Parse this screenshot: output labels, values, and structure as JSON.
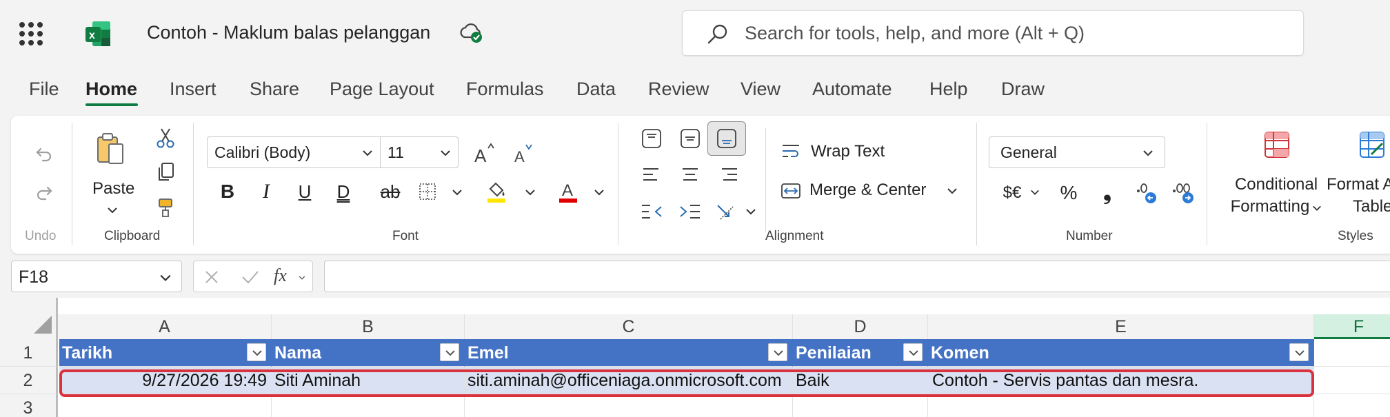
{
  "app": {
    "doc_title": "Contoh - Maklum balas pelanggan",
    "search_placeholder": "Search for tools, help, and more (Alt + Q)",
    "brand_color": "#107c41"
  },
  "menu_tabs": [
    {
      "label": "File",
      "active": false
    },
    {
      "label": "Home",
      "active": true
    },
    {
      "label": "Insert",
      "active": false
    },
    {
      "label": "Share",
      "active": false
    },
    {
      "label": "Page Layout",
      "active": false
    },
    {
      "label": "Formulas",
      "active": false
    },
    {
      "label": "Data",
      "active": false
    },
    {
      "label": "Review",
      "active": false
    },
    {
      "label": "View",
      "active": false
    },
    {
      "label": "Automate",
      "active": false
    },
    {
      "label": "Help",
      "active": false
    },
    {
      "label": "Draw",
      "active": false
    }
  ],
  "ribbon": {
    "undo": {
      "label": "Undo"
    },
    "clipboard": {
      "label": "Clipboard",
      "paste_label": "Paste"
    },
    "font": {
      "label": "Font",
      "family": "Calibri (Body)",
      "size": "11",
      "fill_color": "#ffe600",
      "font_color": "#e00000"
    },
    "alignment": {
      "label": "Alignment",
      "wrap_text": "Wrap Text",
      "merge_center": "Merge & Center"
    },
    "number": {
      "label": "Number",
      "format": "General",
      "currency_symbol": "$€",
      "percent_symbol": "%",
      "comma_symbol": "❟"
    },
    "styles": {
      "label": "Styles",
      "conditional_line1": "Conditional",
      "conditional_line2": "Formatting",
      "format_table_line1": "Format As",
      "format_table_line2": "Table"
    }
  },
  "formula_bar": {
    "name_box": "F18",
    "fx_label": "fx",
    "formula_value": ""
  },
  "sheet": {
    "columns": [
      "A",
      "B",
      "C",
      "D",
      "E",
      "F"
    ],
    "selected_column": "F",
    "rows": [
      "1",
      "2",
      "3"
    ],
    "header_row": [
      "Tarikh",
      "Nama",
      "Emel",
      "Penilaian",
      "Komen"
    ],
    "data_rows": [
      [
        "9/27/2026 19:49",
        "Siti Aminah",
        "siti.aminah@officeniaga.onmicrosoft.com",
        "Baik",
        "Contoh - Servis pantas dan mesra."
      ]
    ],
    "table_header_color": "#4472c4",
    "table_band_color": "#d9e1f2",
    "highlight_color": "#d9323e"
  }
}
